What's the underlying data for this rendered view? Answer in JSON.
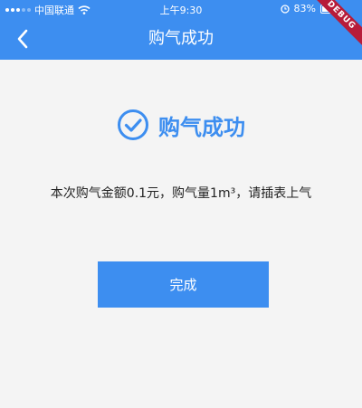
{
  "status_bar": {
    "carrier": "中国联通",
    "time": "上午9:30",
    "battery": "83%"
  },
  "debug_banner": "DEBUG",
  "nav": {
    "title": "购气成功",
    "back_icon": "chevron-left-icon"
  },
  "result": {
    "icon": "check-circle-icon",
    "title": "购气成功",
    "description": "本次购气金额0.1元，购气量1m³，请插表上气"
  },
  "actions": {
    "done_label": "完成"
  },
  "colors": {
    "primary": "#3d8ef0",
    "background": "#f4f4f4",
    "debug": "#b71c3a"
  }
}
